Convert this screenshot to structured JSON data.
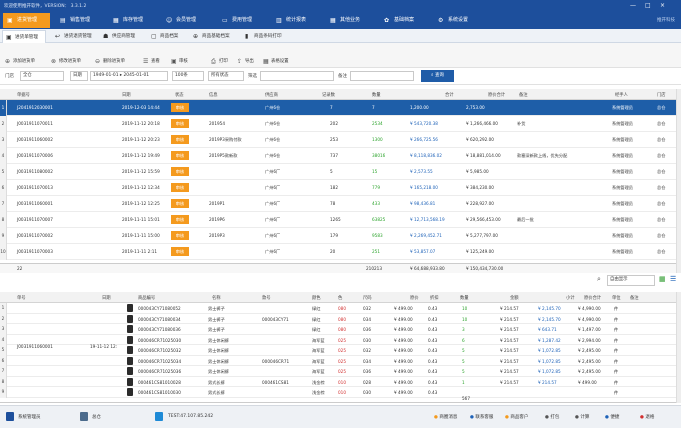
{
  "window": {
    "title": "欢迎使用推开软件，VERSION： 3.3.1.2",
    "brand": "推开科技",
    "controls": [
      "—",
      "□",
      "×"
    ]
  },
  "menus": [
    {
      "label": "进货管理",
      "active": true
    },
    {
      "label": "销售管理",
      "active": false
    },
    {
      "label": "库存管理",
      "active": false
    },
    {
      "label": "会员管理",
      "active": false
    },
    {
      "label": "费用管理",
      "active": false
    },
    {
      "label": "统计报表",
      "active": false
    },
    {
      "label": "其他业务",
      "active": false
    },
    {
      "label": "基础档案",
      "active": false
    },
    {
      "label": "系统设置",
      "active": false
    }
  ],
  "tabs": [
    {
      "label": "进货单管理",
      "active": true
    },
    {
      "label": "进货退货管理",
      "active": false
    },
    {
      "label": "供应商管理",
      "active": false
    },
    {
      "label": "商品档案",
      "active": false
    },
    {
      "label": "商品基础档案",
      "active": false
    },
    {
      "label": "商品条码打印",
      "active": false
    }
  ],
  "toolbar": [
    {
      "label": "添加进货单"
    },
    {
      "label": "修改进货单"
    },
    {
      "label": "删除进货单"
    },
    {
      "label": "查看"
    },
    {
      "label": "审核"
    },
    {
      "label": "打印"
    },
    {
      "label": "导出"
    },
    {
      "label": "表格设置"
    }
  ],
  "filter": {
    "store_label": "门店",
    "store_value": "全仓",
    "date_type": "日期",
    "date_range": "1949-01-01 ▸ 2045-01-01",
    "page_size": "100条",
    "status": "所有状态",
    "text_label": "筛选",
    "remark_label": "备注",
    "query_label": "查询"
  },
  "main_grid": {
    "headers": [
      "单据号",
      "日期",
      "状态",
      "信息",
      "供应商",
      "记录数",
      "数量",
      "合计",
      "原价合计",
      "备注",
      "经手人",
      "门店"
    ],
    "rows": [
      {
        "n": "1",
        "no": "J2041912030001",
        "date": "2019-12-03 14:44",
        "status": "审核",
        "info": "",
        "supplier": "广州6仓",
        "records": "7",
        "qty": "7",
        "total": "1,200.00",
        "orig": "2,753.00",
        "remark": "",
        "handler": "系统管理员",
        "store": "总仓"
      },
      {
        "n": "2",
        "no": "J0031911070011",
        "date": "2019-11-12 20:18",
        "status": "审核",
        "info": "201954",
        "supplier": "广州6仓",
        "records": "202",
        "qty": "2534",
        "total": "¥ 543,720.38",
        "orig": "¥ 1,266,466.00",
        "remark": "补货",
        "handler": "系统管理员",
        "store": "总仓"
      },
      {
        "n": "3",
        "no": "J0031911060002",
        "date": "2019-11-12 20:23",
        "status": "审核",
        "info": "2019P3采购付款",
        "supplier": "广州6仓",
        "records": "253",
        "qty": "1300",
        "total": "¥ 266,725.56",
        "orig": "¥ 620,292.00",
        "remark": "",
        "handler": "系统管理员",
        "store": "总仓"
      },
      {
        "n": "4",
        "no": "J0031911070006",
        "date": "2019-11-12 19:49",
        "status": "审核",
        "info": "2019P5款新款",
        "supplier": "广州6仓",
        "records": "737",
        "qty": "38016",
        "total": "¥ 8,118,836.02",
        "orig": "¥ 18,881,014.00",
        "remark": "款塞深新款上线，优先分配",
        "handler": "系统管理员",
        "store": "总仓"
      },
      {
        "n": "5",
        "no": "J0031911080002",
        "date": "2019-11-12 15:59",
        "status": "审核",
        "info": "",
        "supplier": "广州6厂",
        "records": "5",
        "qty": "15",
        "total": "¥ 2,573.55",
        "orig": "¥ 5,985.00",
        "remark": "",
        "handler": "系统管理员",
        "store": "总仓"
      },
      {
        "n": "6",
        "no": "J0031911070013",
        "date": "2019-11-12 12:34",
        "status": "审核",
        "info": "",
        "supplier": "广州6厂",
        "records": "182",
        "qty": "779",
        "total": "¥ 165,218.00",
        "orig": "¥ 384,230.00",
        "remark": "",
        "handler": "系统管理员",
        "store": "总仓"
      },
      {
        "n": "7",
        "no": "J0031911060001",
        "date": "2019-11-12 12:25",
        "status": "审核",
        "info": "2019P1",
        "supplier": "广州6厂",
        "records": "78",
        "qty": "433",
        "total": "¥ 98,436.81",
        "orig": "¥ 228,927.00",
        "remark": "",
        "handler": "系统管理员",
        "store": "总仓"
      },
      {
        "n": "8",
        "no": "J0031911070007",
        "date": "2019-11-11 15:01",
        "status": "审核",
        "info": "2019P6",
        "supplier": "广州6厂",
        "records": "1265",
        "qty": "63825",
        "total": "¥ 12,713,568.19",
        "orig": "¥ 29,566,453.00",
        "remark": "最后一批",
        "handler": "系统管理员",
        "store": "总仓"
      },
      {
        "n": "9",
        "no": "J0031911070002",
        "date": "2019-11-11 15:00",
        "status": "审核",
        "info": "2019P3",
        "supplier": "广州6厂",
        "records": "179",
        "qty": "9583",
        "total": "¥ 2,269,452.71",
        "orig": "¥ 5,277,797.00",
        "remark": "",
        "handler": "系统管理员",
        "store": "总仓"
      },
      {
        "n": "10",
        "no": "J0031911070003",
        "date": "2019-11-11 2:11",
        "status": "审核",
        "info": "",
        "supplier": "广州6厂",
        "records": "20",
        "qty": "251",
        "total": "¥ 53,857.07",
        "orig": "¥ 125,249.00",
        "remark": "",
        "handler": "系统管理员",
        "store": "总仓"
      }
    ],
    "totals": {
      "count": "22",
      "qty": "210213",
      "total": "¥ 64,688,933.80",
      "orig": "¥ 150,434,730.00"
    }
  },
  "sub_toolbar": {
    "display_value": "自由显示"
  },
  "detail_grid": {
    "headers": [
      "单号",
      "日期",
      "商品编号",
      "名称",
      "款号",
      "颜色",
      "色",
      "尺码",
      "原价",
      "折扣",
      "数量",
      "金额",
      "小计",
      "原价合计",
      "单位",
      "备注"
    ],
    "order_no": "J0031911060001",
    "order_date": "19-11-12 12:",
    "rows": [
      {
        "n": "1",
        "code": "000043CY71080052",
        "name": "男士裤子",
        "style": "",
        "color": "绿红",
        "cc": "080",
        "size": "032",
        "orig": "¥ 499.00",
        "disc": "0.43",
        "qty": "10",
        "amount": "¥ 214.57",
        "sub": "¥ 2,145.70",
        "origsum": "¥ 4,990.00",
        "unit": "件"
      },
      {
        "n": "2",
        "code": "000043CY71080034",
        "name": "男士裤子",
        "style": "000043CY71",
        "color": "绿红",
        "cc": "080",
        "size": "034",
        "orig": "¥ 499.00",
        "disc": "0.43",
        "qty": "10",
        "amount": "¥ 214.57",
        "sub": "¥ 2,145.70",
        "origsum": "¥ 4,990.00",
        "unit": "件"
      },
      {
        "n": "3",
        "code": "000043CY71080036",
        "name": "男士裤子",
        "style": "",
        "color": "绿红",
        "cc": "080",
        "size": "036",
        "orig": "¥ 499.00",
        "disc": "0.43",
        "qty": "3",
        "amount": "¥ 214.57",
        "sub": "¥ 643.71",
        "origsum": "¥ 1,497.00",
        "unit": "件"
      },
      {
        "n": "4",
        "code": "000046CR71025030",
        "name": "男士休闲裤",
        "style": "",
        "color": "海军蓝",
        "cc": "025",
        "size": "030",
        "orig": "¥ 499.00",
        "disc": "0.43",
        "qty": "6",
        "amount": "¥ 214.57",
        "sub": "¥ 1,287.42",
        "origsum": "¥ 2,994.00",
        "unit": "件"
      },
      {
        "n": "5",
        "code": "000046CR71025032",
        "name": "男士休闲裤",
        "style": "",
        "color": "海军蓝",
        "cc": "025",
        "size": "032",
        "orig": "¥ 499.00",
        "disc": "0.43",
        "qty": "5",
        "amount": "¥ 214.57",
        "sub": "¥ 1,072.85",
        "origsum": "¥ 2,495.00",
        "unit": "件"
      },
      {
        "n": "6",
        "code": "000046CR71025034",
        "name": "男士休闲裤",
        "style": "000046CR71",
        "color": "海军蓝",
        "cc": "025",
        "size": "034",
        "orig": "¥ 499.00",
        "disc": "0.43",
        "qty": "5",
        "amount": "¥ 214.57",
        "sub": "¥ 1,072.85",
        "origsum": "¥ 2,495.00",
        "unit": "件"
      },
      {
        "n": "7",
        "code": "000046CR71025036",
        "name": "男士休闲裤",
        "style": "",
        "color": "海军蓝",
        "cc": "025",
        "size": "036",
        "orig": "¥ 499.00",
        "disc": "0.43",
        "qty": "5",
        "amount": "¥ 214.57",
        "sub": "¥ 1,072.85",
        "origsum": "¥ 2,495.00",
        "unit": "件"
      },
      {
        "n": "8",
        "code": "000461CS81010028",
        "name": "男式长裤",
        "style": "000461CS81",
        "color": "浅金棕",
        "cc": "010",
        "size": "028",
        "orig": "¥ 499.00",
        "disc": "0.43",
        "qty": "1",
        "amount": "¥ 214.57",
        "sub": "¥ 214.57",
        "origsum": "¥ 499.00",
        "unit": "件"
      },
      {
        "n": "9",
        "code": "000461CS81010030",
        "name": "男式长裤",
        "style": "",
        "color": "浅金棕",
        "cc": "010",
        "size": "030",
        "orig": "¥ 499.00",
        "disc": "0.43",
        "qty": "",
        "amount": "",
        "sub": "",
        "origsum": "",
        "unit": "件"
      }
    ],
    "total_qty": "567"
  },
  "status": {
    "user": "系统管理员",
    "store": "总仓",
    "server": "TEST:47.107.85.242",
    "actions": [
      "商圈消息",
      "联系客服",
      "商品客户",
      "打包",
      "计算",
      "便捷",
      "退格"
    ]
  }
}
